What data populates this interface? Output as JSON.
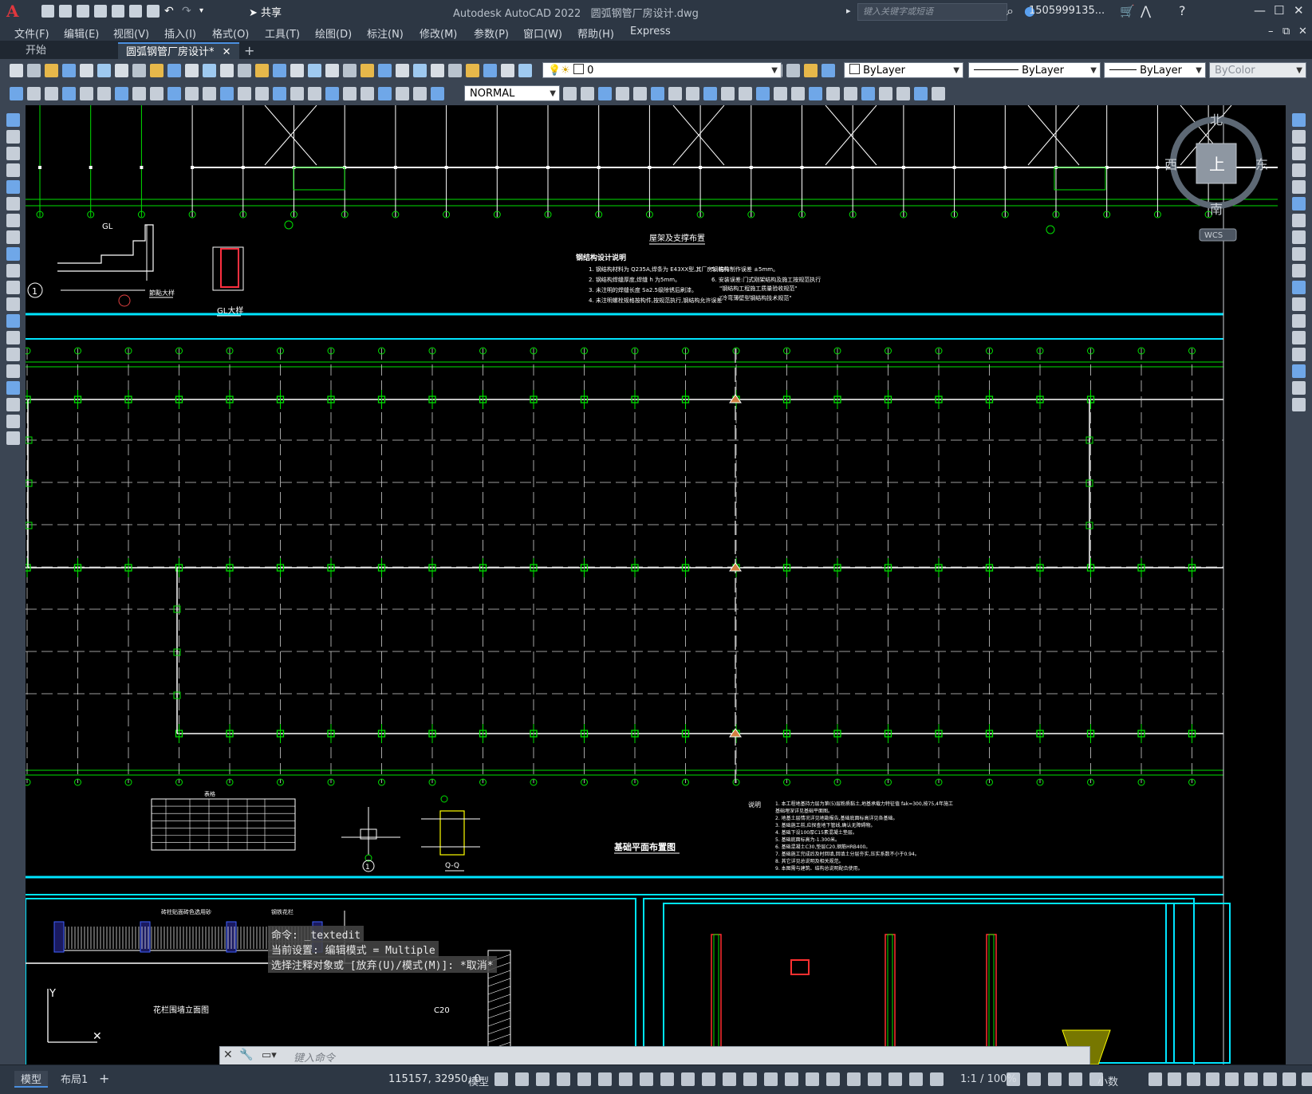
{
  "window": {
    "app_title": "Autodesk AutoCAD 2022",
    "file_title": "圆弧钢管厂房设计.dwg",
    "search_placeholder": "键入关键字或短语",
    "user": "1505999135...",
    "share_label": "共享"
  },
  "menu": [
    "文件(F)",
    "编辑(E)",
    "视图(V)",
    "插入(I)",
    "格式(O)",
    "工具(T)",
    "绘图(D)",
    "标注(N)",
    "修改(M)",
    "参数(P)",
    "窗口(W)",
    "帮助(H)",
    "Express"
  ],
  "tabs": [
    {
      "label": "开始"
    },
    {
      "label": "圆弧钢管厂房设计*"
    }
  ],
  "toolbar": {
    "layer_value": "0",
    "color_value": "ByLayer",
    "linetype_value": "ByLayer",
    "lineweight_value": "ByLayer",
    "plotstyle_value": "ByColor",
    "dimstyle_value": "NORMAL"
  },
  "viewcube": {
    "north": "北",
    "south": "南",
    "west": "西",
    "east": "东",
    "top": "上",
    "wcs": "WCS"
  },
  "drawing": {
    "roof_title": "屋架及支撑布置",
    "steel_notes_title": "钢结构设计说明",
    "steel_notes": [
      "1. 钢结构材料为 Q235A,焊条为 E43XX型,其厂房钢结构",
      "2. 钢结构焊缝厚度,焊缝 h 为5mm。",
      "3. 未注明的焊缝长度 Sa2.5级除锈后刷漆。",
      "4. 未注明螺栓规格按构件,按规范执行,钢结构允许误差"
    ],
    "steel_notes_b": [
      "5. 构件制作误差 ±5mm。",
      "6. 安装误差:门式刚架结构及施工按规范执行",
      "\"钢结构工程施工质量验收规范\"",
      "\"冷弯薄壁型钢结构技术规范\""
    ],
    "gl_label": "GL",
    "gl_title": "GL大样",
    "detail_title": "節點大样",
    "foundation_title": "基础平面布置图",
    "table_title": "表格",
    "notes_title": "说明",
    "foundation_notes": [
      "1. 本工程地基持力层为第(5)层粉质黏土,地基承载力特征值 fak=300,按75,4年施工",
      "   基础埋深详见基础平面图。",
      "2. 地基土层情况详见地勘报告,基础底面标高详见各基础。",
      "3. 基础施工前,应探查地下管线,确认无障碍物。",
      "4. 基础下设100厚C15素混凝土垫层。",
      "5. 基础底面标高为-1.300米。",
      "6. 基础混凝土C30,垫层C20,钢筋HRB400。",
      "7. 基础施工完成后及时回填,回填土分层夯实,压实系数不小于0.94。",
      "8. 其它详见总说明及相关规范。",
      "9. 本图需与建筑、结构总说明配合使用。"
    ],
    "section_label": "Q-Q",
    "fence_label": "花栏围墙立面图",
    "fence_note_1": "砖柱贴面砖色选用砂",
    "fence_note_2": "钢铁花栏",
    "circle_1": "1",
    "c20_label": "C20"
  },
  "command": {
    "history": [
      "命令: _textedit",
      "当前设置: 编辑模式 = Multiple",
      "选择注释对象或 [放弃(U)/模式(M)]: *取消*"
    ],
    "placeholder": "键入命令"
  },
  "status": {
    "model_tab": "模型",
    "layout_tab": "布局1",
    "coordinates": "115157, 32950, 0",
    "space": "模型",
    "scale": "1:1 / 100%",
    "units": "小数"
  },
  "colors": {
    "accent": "#4a8fe0",
    "grid_green": "#00e000",
    "frame_cyan": "#00e5ff",
    "canvas": "#000000"
  }
}
